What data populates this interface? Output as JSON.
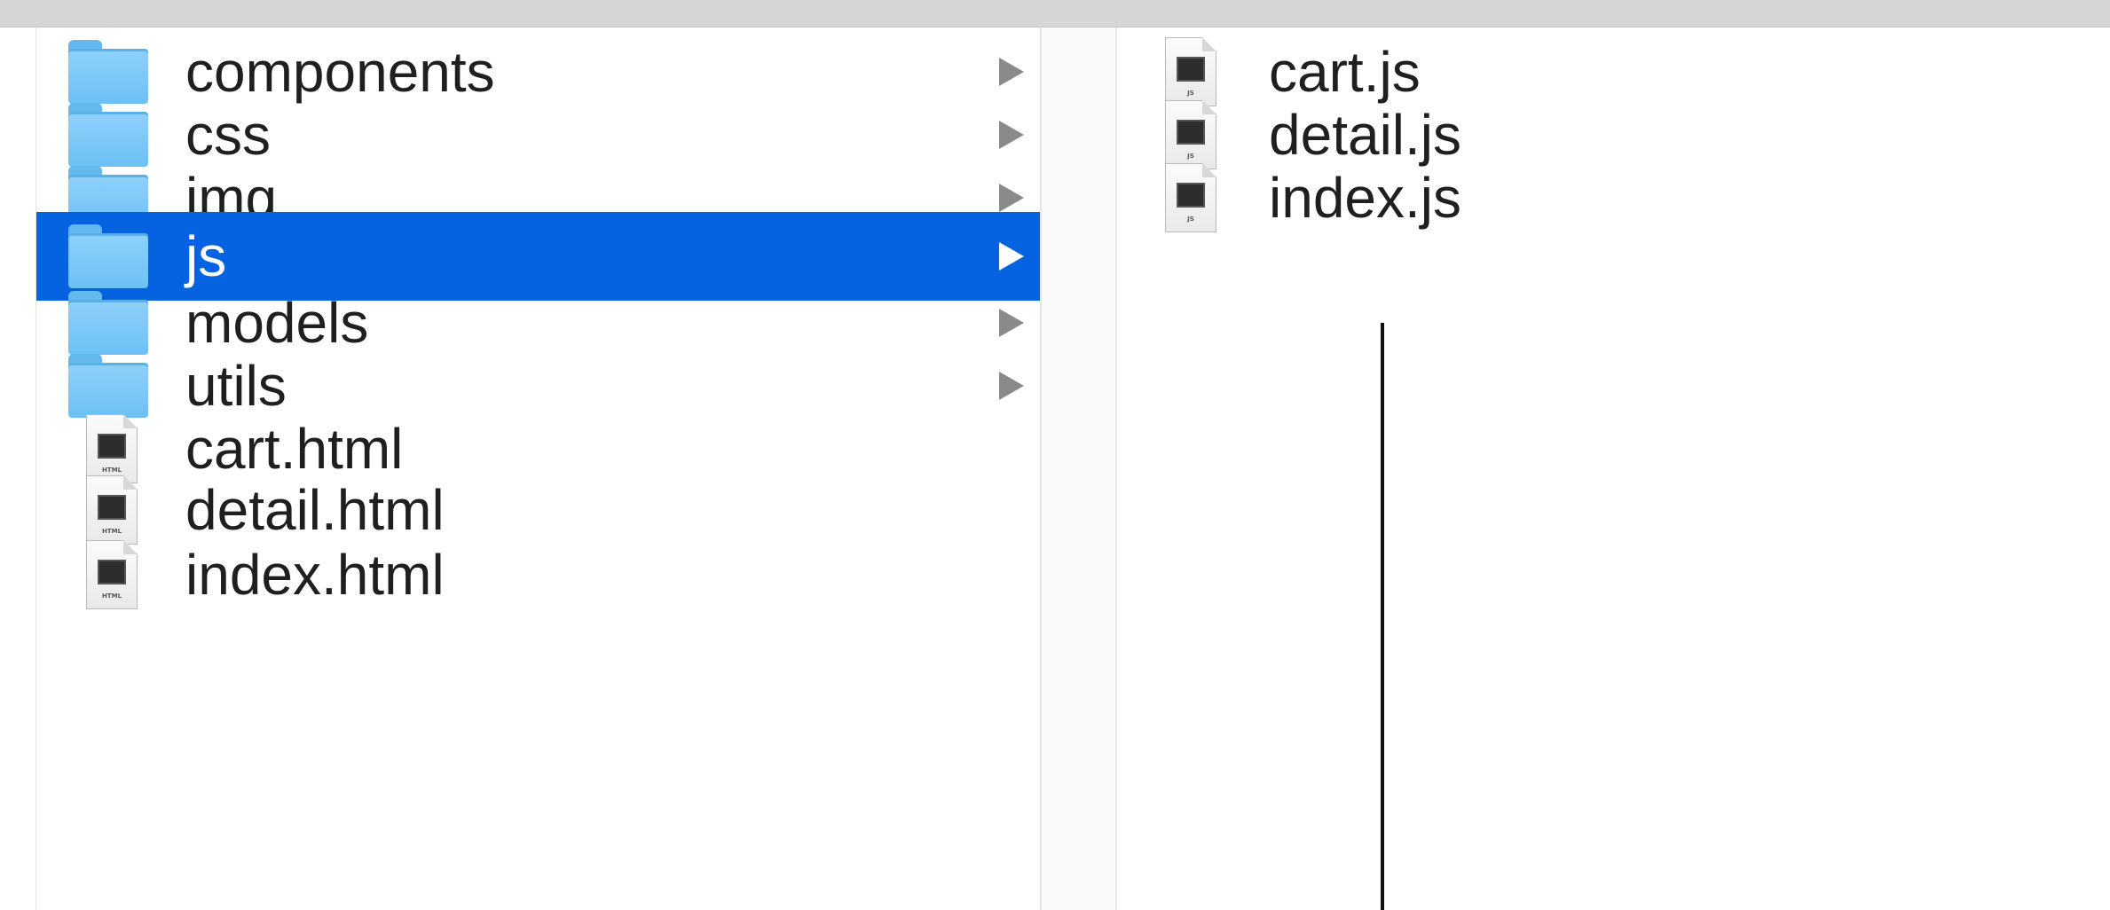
{
  "column1": {
    "items": [
      {
        "label": "components",
        "kind": "folder",
        "icon": "folder-icon"
      },
      {
        "label": "css",
        "kind": "folder",
        "icon": "folder-icon"
      },
      {
        "label": "img",
        "kind": "folder",
        "icon": "folder-icon"
      },
      {
        "label": "js",
        "kind": "folder",
        "icon": "folder-icon",
        "selected": true
      },
      {
        "label": "models",
        "kind": "folder",
        "icon": "folder-icon"
      },
      {
        "label": "utils",
        "kind": "folder",
        "icon": "folder-icon"
      },
      {
        "label": "cart.html",
        "kind": "file",
        "icon": "html-file-icon",
        "tag": "HTML"
      },
      {
        "label": "detail.html",
        "kind": "file",
        "icon": "html-file-icon",
        "tag": "HTML"
      },
      {
        "label": "index.html",
        "kind": "file",
        "icon": "html-file-icon",
        "tag": "HTML"
      }
    ]
  },
  "column2": {
    "items": [
      {
        "label": "cart.js",
        "kind": "file",
        "icon": "js-file-icon",
        "tag": "JS"
      },
      {
        "label": "detail.js",
        "kind": "file",
        "icon": "js-file-icon",
        "tag": "JS"
      },
      {
        "label": "index.js",
        "kind": "file",
        "icon": "js-file-icon",
        "tag": "JS"
      }
    ]
  },
  "colors": {
    "selection": "#0563e1",
    "folder": "#6cc0f5",
    "text": "#1f1f1f",
    "chevron": "#8a8a8a"
  }
}
